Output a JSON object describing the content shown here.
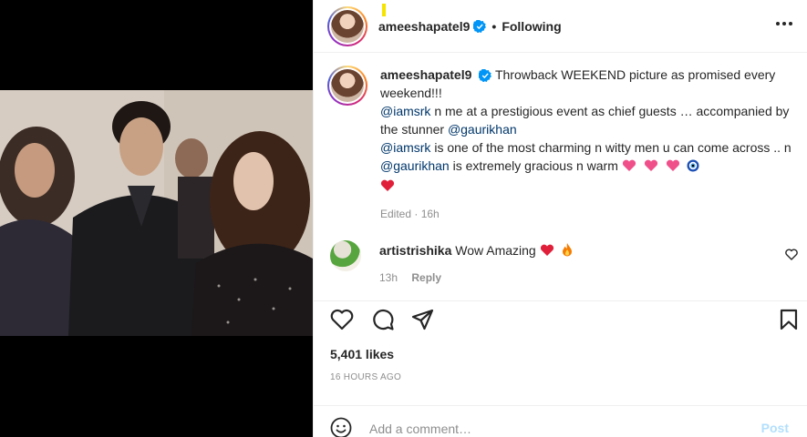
{
  "header": {
    "username": "ameeshapatel9",
    "separator": "•",
    "follow_status": "Following",
    "more_icon": "more-horizontal-icon"
  },
  "caption": {
    "username": "ameeshapatel9",
    "line1": "Throwback WEEKEND picture as promised every weekend!!!",
    "mention_srk": "@iamsrk",
    "line2": " n me at a prestigious event as chief guests … accompanied by the stunner ",
    "mention_gauri": "@gaurikhan",
    "line3": " is one of the most charming n witty men u can come across .. n ",
    "line4": " is extremely gracious n warm",
    "edited": "Edited",
    "time": "16h"
  },
  "comment": {
    "username": "artistrishika",
    "text": "Wow Amazing",
    "time": "13h",
    "reply_label": "Reply"
  },
  "stats": {
    "likes": "5,401 likes",
    "posted": "16 HOURS AGO"
  },
  "add_comment": {
    "placeholder": "Add a comment…",
    "post_label": "Post"
  },
  "colors": {
    "verified": "#0095f6",
    "heart_red": "#e0203a",
    "pink_heart": "#f0508a",
    "link": "#00376b",
    "post_disabled": "#b2dffc"
  }
}
